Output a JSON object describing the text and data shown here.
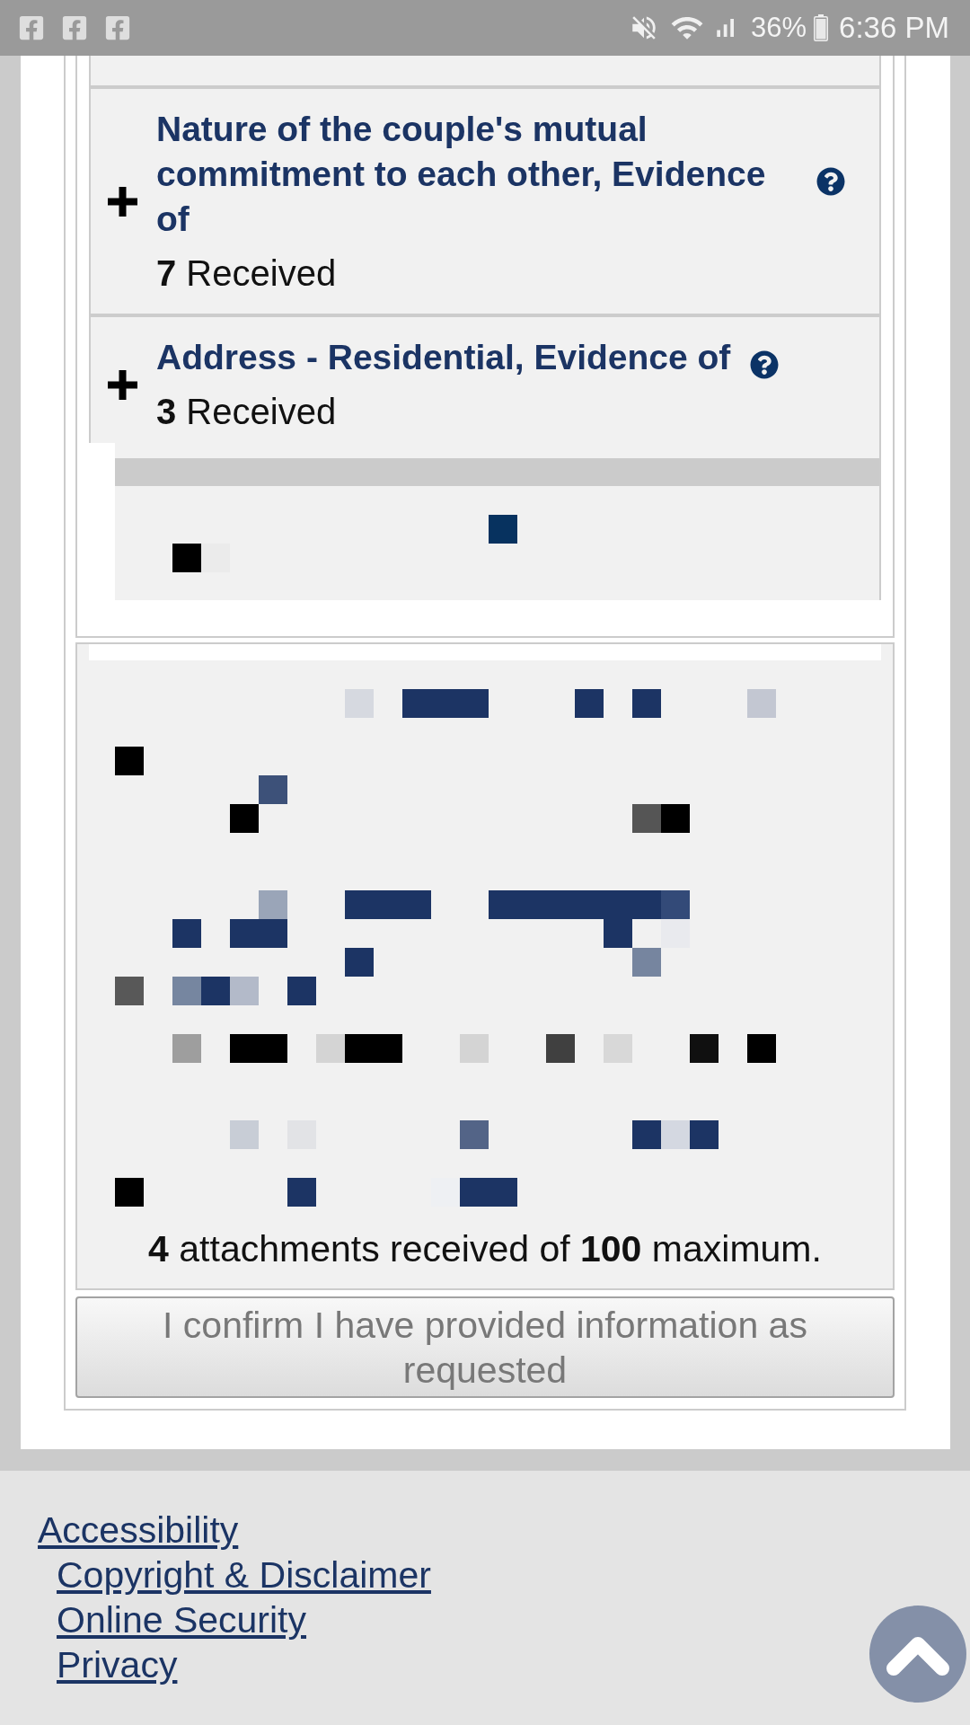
{
  "status_bar": {
    "battery": "36%",
    "time": "6:36 PM"
  },
  "accordion": {
    "items": [
      {
        "title": "Nature of the couple's mutual commitment to each other, Evidence of",
        "received": "**7** Received",
        "expanded": false
      },
      {
        "title": "Address - Residential, Evidence of",
        "received": "**3** Received",
        "expanded": false
      }
    ]
  },
  "attachments": {
    "summary": "**4** attachments received of **100** maximum."
  },
  "confirm_button": {
    "label": "I confirm I have provided information as requested",
    "disabled": true
  },
  "footer": {
    "links": [
      "Accessibility",
      "Copyright & Disclaimer",
      "Online Security",
      "Privacy"
    ]
  }
}
